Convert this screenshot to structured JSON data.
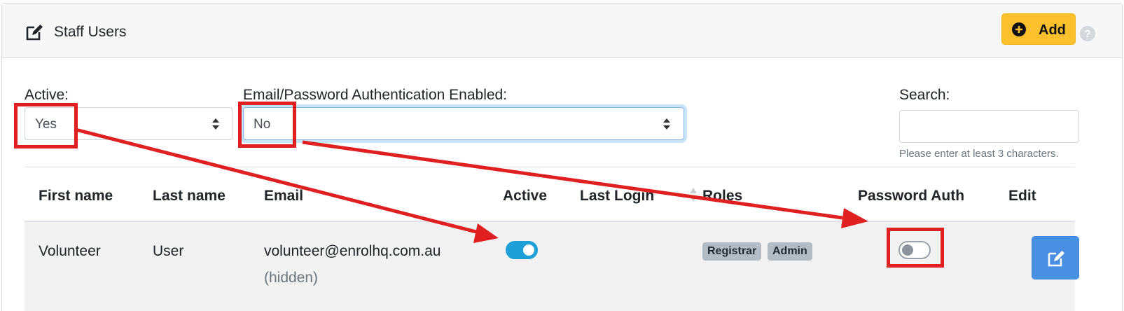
{
  "header": {
    "title": "Staff Users",
    "title_icon": "edit-icon",
    "add_label": "Add",
    "add_icon": "plus-circle-icon",
    "help_icon": "question-circle-icon",
    "add_color": "#fbc02d"
  },
  "filters": {
    "active": {
      "label": "Active:",
      "value": "Yes"
    },
    "password_auth": {
      "label": "Email/Password Authentication Enabled:",
      "value": "No"
    },
    "search": {
      "label": "Search:",
      "value": "",
      "hint": "Please enter at least 3 characters."
    }
  },
  "table": {
    "columns": [
      "First name",
      "Last name",
      "Email",
      "Active",
      "Last Login",
      "Roles",
      "Password Auth",
      "Edit"
    ],
    "rows": [
      {
        "first_name": "Volunteer",
        "last_name": "User",
        "email": "volunteer@enrolhq.com.au",
        "email_note": "(hidden)",
        "active": true,
        "last_login": "",
        "roles": [
          "Registrar",
          "Admin"
        ],
        "password_auth": false
      }
    ]
  },
  "colors": {
    "toggle_on": "#1e9fd8",
    "edit_button": "#4a90e2",
    "annotation": "#e02020"
  }
}
